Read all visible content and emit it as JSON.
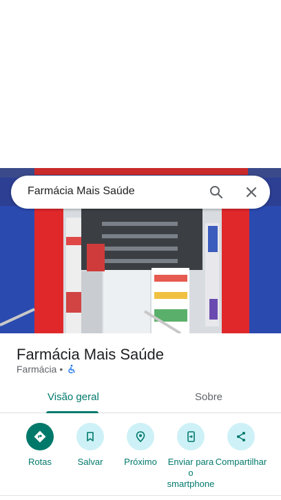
{
  "search": {
    "query": "Farmácia Mais Saúde"
  },
  "place": {
    "title": "Farmácia Mais Saúde",
    "category": "Farmácia",
    "separator": "•",
    "wheelchair_accessible": true
  },
  "tabs": [
    {
      "label": "Visão geral",
      "active": true
    },
    {
      "label": "Sobre",
      "active": false
    }
  ],
  "actions": [
    {
      "label": "Rotas",
      "icon": "directions-icon"
    },
    {
      "label": "Salvar",
      "icon": "bookmark-icon"
    },
    {
      "label": "Próximo",
      "icon": "nearby-icon"
    },
    {
      "label": "Enviar para o smartphone",
      "icon": "send-to-phone-icon"
    },
    {
      "label": "Compartilhar",
      "icon": "share-icon"
    }
  ],
  "colors": {
    "accent": "#00796b",
    "action_bg": "#cdf1f6",
    "text": "#202124",
    "secondary": "#5f6368"
  }
}
